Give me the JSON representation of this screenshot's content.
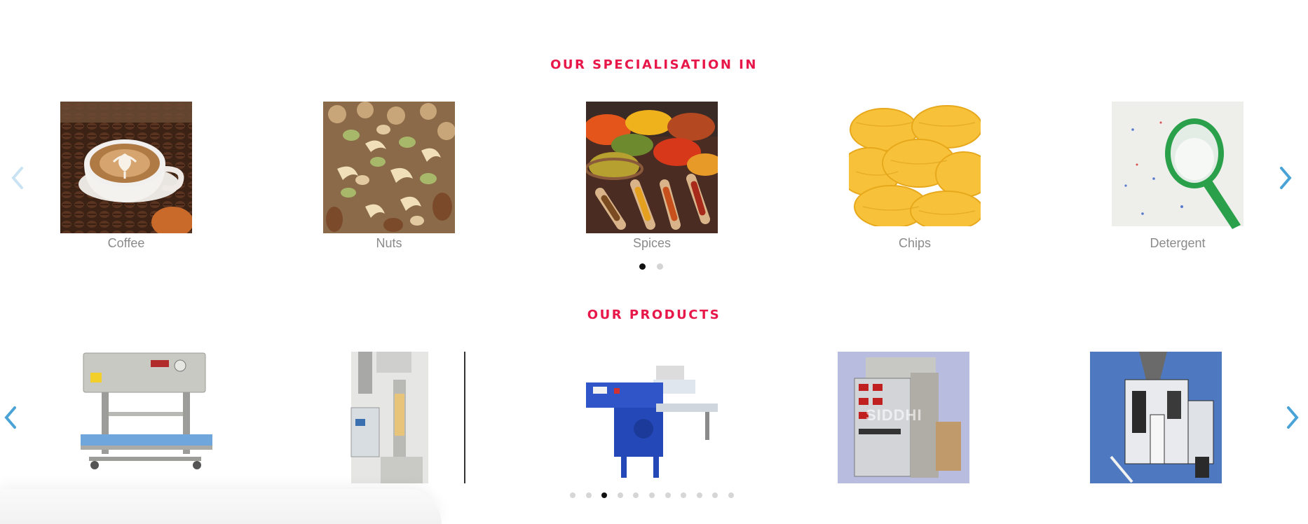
{
  "specialisation": {
    "title": "OUR SPECIALISATION IN",
    "items": [
      {
        "label": "Coffee"
      },
      {
        "label": "Nuts"
      },
      {
        "label": "Spices"
      },
      {
        "label": "Chips"
      },
      {
        "label": "Detergent"
      }
    ],
    "pagination": {
      "count": 2,
      "active": 1
    }
  },
  "products": {
    "title": "OUR PRODUCTS",
    "items": [
      {
        "name": "band-sealer-machine"
      },
      {
        "name": "vertical-pouch-packing-machine"
      },
      {
        "name": "flow-wrap-packing-machine"
      },
      {
        "name": "pouch-packing-machine"
      },
      {
        "name": "collar-type-packing-machine"
      }
    ],
    "watermark": "SIDDHI",
    "pagination": {
      "count": 11,
      "active": 3
    }
  },
  "colors": {
    "accent": "#e8174a",
    "arrow": "#4aa3d6",
    "arrow_faded": "#c9e3f3"
  },
  "icons": {
    "prev": "chevron-left-icon",
    "next": "chevron-right-icon"
  }
}
